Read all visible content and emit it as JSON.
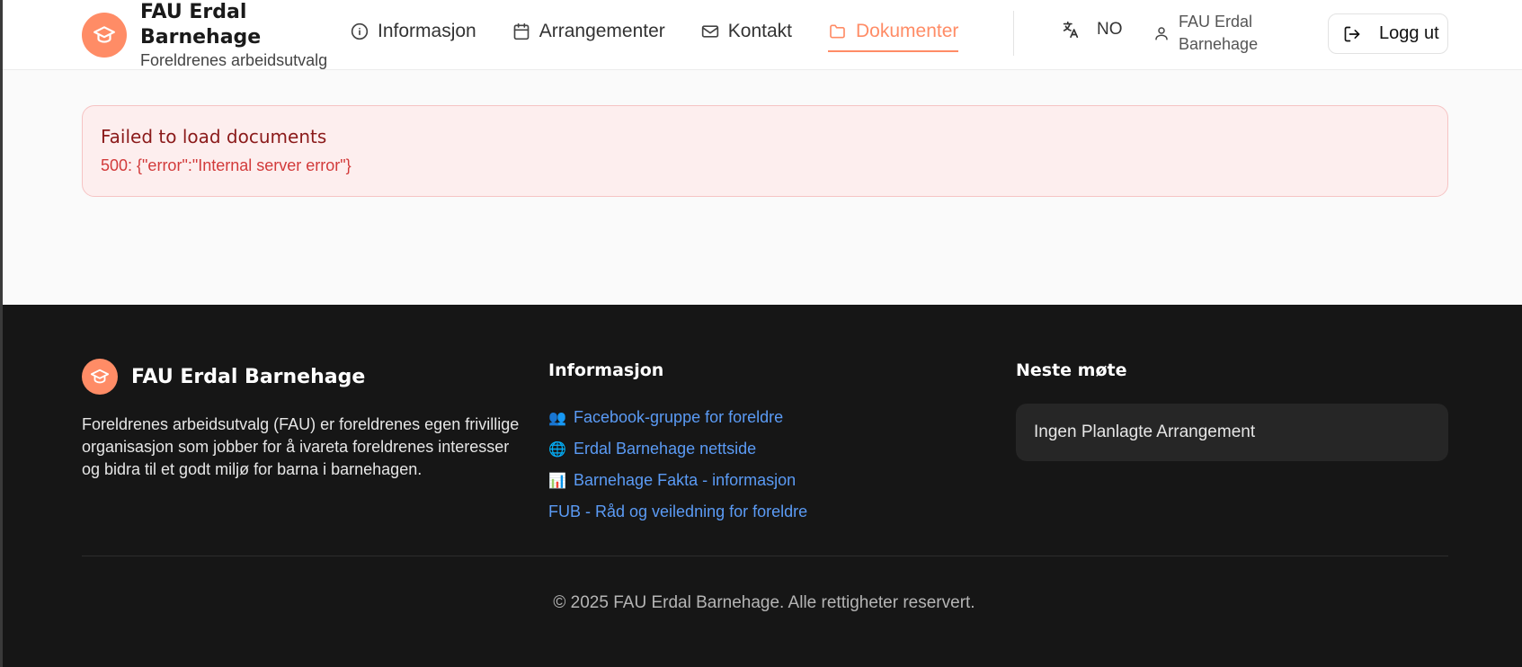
{
  "header": {
    "brand_title": "FAU Erdal Barnehage",
    "brand_subtitle": "Foreldrenes arbeidsutvalg",
    "nav": [
      {
        "label": "Informasjon",
        "icon": "info-icon",
        "active": false
      },
      {
        "label": "Arrangementer",
        "icon": "calendar-icon",
        "active": false
      },
      {
        "label": "Kontakt",
        "icon": "mail-icon",
        "active": false
      },
      {
        "label": "Dokumenter",
        "icon": "folder-icon",
        "active": true
      }
    ],
    "language": "NO",
    "user_name": "FAU Erdal Barnehage",
    "logout_label": "Logg ut"
  },
  "error": {
    "title": "Failed to load documents",
    "message": "500: {\"error\":\"Internal server error\"}"
  },
  "footer": {
    "brand_name": "FAU Erdal Barnehage",
    "description": "Foreldrenes arbeidsutvalg (FAU) er foreldrenes egen frivillige organisasjon som jobber for å ivareta foreldrenes interesser og bidra til et godt miljø for barna i barnehagen.",
    "info_title": "Informasjon",
    "links": [
      {
        "emoji": "👥",
        "label": "Facebook-gruppe for foreldre"
      },
      {
        "emoji": "🌐",
        "label": "Erdal Barnehage nettside"
      },
      {
        "emoji": "📊",
        "label": "Barnehage Fakta - informasjon"
      },
      {
        "emoji": "",
        "label": "FUB - Råd og veiledning for foreldre"
      }
    ],
    "meeting_title": "Neste møte",
    "meeting_text": "Ingen Planlagte Arrangement",
    "copyright": "© 2025 FAU Erdal Barnehage. Alle rettigheter reservert."
  },
  "colors": {
    "accent": "#ff8c66",
    "link": "#5b9bf5",
    "error_bg": "#fdeeee",
    "error_text": "#d23a3a",
    "footer_bg": "#161616"
  }
}
